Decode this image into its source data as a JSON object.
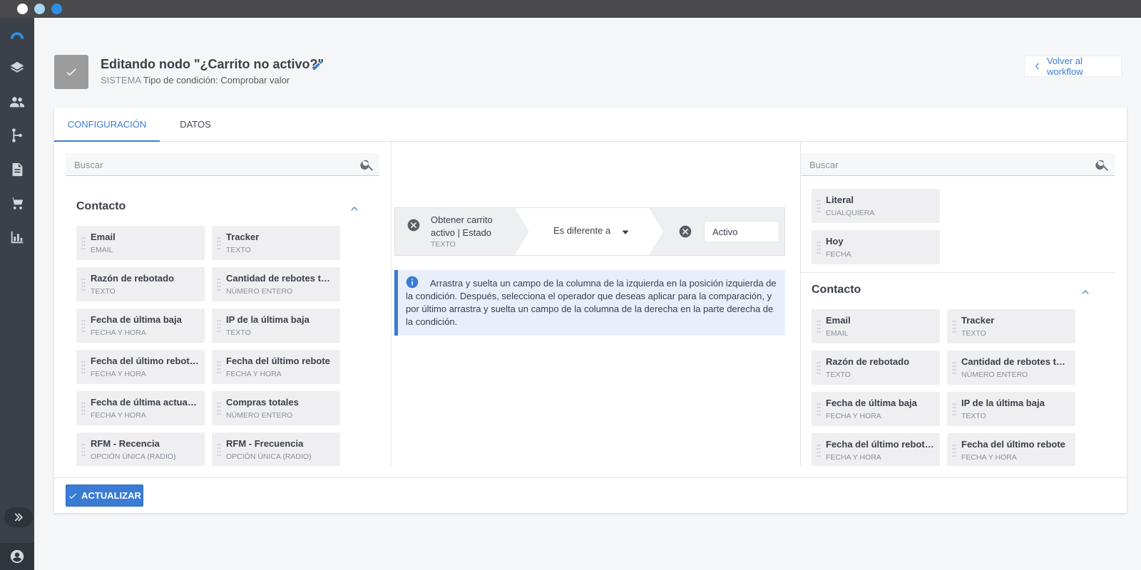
{
  "header": {
    "title": "Editando nodo \"¿Carrito no activo?\"",
    "system_label": "SISTEMA",
    "condition_type": "Tipo de condición: Comprobar valor",
    "back_label": "Volver al workflow"
  },
  "tabs": [
    {
      "label": "CONFIGURACIÓN",
      "active": true
    },
    {
      "label": "DATOS",
      "active": false
    }
  ],
  "left_panel": {
    "search_placeholder": "Buscar",
    "section_title": "Contacto",
    "fields": [
      {
        "name": "Email",
        "type": "EMAIL"
      },
      {
        "name": "Tracker",
        "type": "TEXTO"
      },
      {
        "name": "Razón de rebotado",
        "type": "TEXTO"
      },
      {
        "name": "Cantidad de rebotes temporales",
        "type": "NÚMERO ENTERO"
      },
      {
        "name": "Fecha de última baja",
        "type": "FECHA Y HORA"
      },
      {
        "name": "IP de la última baja",
        "type": "TEXTO"
      },
      {
        "name": "Fecha del último rebote temporal",
        "type": "FECHA Y HORA"
      },
      {
        "name": "Fecha del último rebote",
        "type": "FECHA Y HORA"
      },
      {
        "name": "Fecha de última actualización",
        "type": "FECHA Y HORA"
      },
      {
        "name": "Compras totales",
        "type": "NÚMERO ENTERO"
      },
      {
        "name": "RFM - Recencia",
        "type": "OPCIÓN ÚNICA (RADIO)"
      },
      {
        "name": "RFM - Frecuencia",
        "type": "OPCIÓN ÚNICA (RADIO)"
      }
    ]
  },
  "condition": {
    "left_field": "Obtener carrito activo | Estado",
    "left_type": "TEXTO",
    "operator": "Es diferente a",
    "value": "Activo"
  },
  "info": {
    "text": "Arrastra y suelta un campo de la columna de la izquierda en la posición izquierda de la condición. Después, selecciona el operador que deseas aplicar para la comparación, y por último arrastra y suelta un campo de la columna de la derecha en la parte derecha de la condición."
  },
  "right_panel": {
    "search_placeholder": "Buscar",
    "special_fields": [
      {
        "name": "Literal",
        "type": "CUALQUIERA"
      },
      {
        "name": "Hoy",
        "type": "FECHA"
      }
    ],
    "section_title": "Contacto",
    "fields": [
      {
        "name": "Email",
        "type": "EMAIL"
      },
      {
        "name": "Tracker",
        "type": "TEXTO"
      },
      {
        "name": "Razón de rebotado",
        "type": "TEXTO"
      },
      {
        "name": "Cantidad de rebotes temporales",
        "type": "NÚMERO ENTERO"
      },
      {
        "name": "Fecha de última baja",
        "type": "FECHA Y HORA"
      },
      {
        "name": "IP de la última baja",
        "type": "TEXTO"
      },
      {
        "name": "Fecha del último rebote temporal",
        "type": "FECHA Y HORA"
      },
      {
        "name": "Fecha del último rebote",
        "type": "FECHA Y HORA"
      }
    ]
  },
  "footer": {
    "update_label": "ACTUALIZAR"
  },
  "colors": {
    "accent": "#3a7bd5",
    "sidebar": "#3b4148",
    "field_bg": "#efeff1"
  }
}
